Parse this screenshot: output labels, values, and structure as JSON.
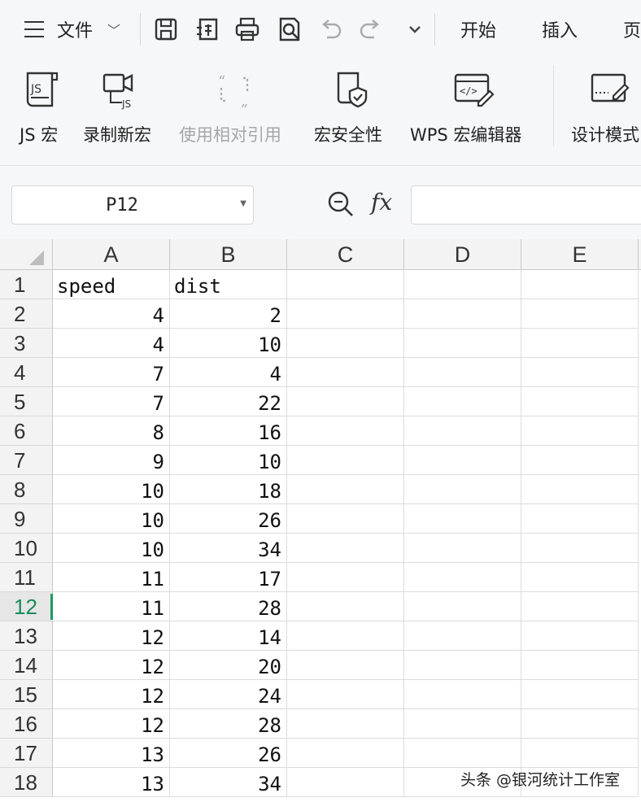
{
  "menubar": {
    "file_label": "文件",
    "quick_access_icons": [
      "save-icon",
      "save-as-icon",
      "print-icon",
      "print-preview-icon",
      "undo-icon",
      "redo-icon",
      "more-dropdown-icon"
    ],
    "tabs": [
      "开始",
      "插入",
      "页"
    ]
  },
  "ribbon": {
    "buttons": [
      {
        "label": "JS 宏",
        "icon": "js-macro-icon",
        "enabled": true
      },
      {
        "label": "录制新宏",
        "icon": "record-macro-icon",
        "enabled": true
      },
      {
        "label": "使用相对引用",
        "icon": "relative-reference-icon",
        "enabled": false
      },
      {
        "label": "宏安全性",
        "icon": "macro-security-icon",
        "enabled": true
      },
      {
        "label": "WPS 宏编辑器",
        "icon": "macro-editor-icon",
        "enabled": true
      },
      {
        "label": "设计模式",
        "icon": "design-mode-icon",
        "enabled": true
      }
    ]
  },
  "formula_bar": {
    "name_box": "P12",
    "fx": "fx",
    "formula": ""
  },
  "sheet": {
    "columns": [
      "A",
      "B",
      "C",
      "D",
      "E"
    ],
    "active_row": "12",
    "rows": [
      {
        "n": "1",
        "a": "speed",
        "b": "dist"
      },
      {
        "n": "2",
        "a": "4",
        "b": "2"
      },
      {
        "n": "3",
        "a": "4",
        "b": "10"
      },
      {
        "n": "4",
        "a": "7",
        "b": "4"
      },
      {
        "n": "5",
        "a": "7",
        "b": "22"
      },
      {
        "n": "6",
        "a": "8",
        "b": "16"
      },
      {
        "n": "7",
        "a": "9",
        "b": "10"
      },
      {
        "n": "8",
        "a": "10",
        "b": "18"
      },
      {
        "n": "9",
        "a": "10",
        "b": "26"
      },
      {
        "n": "10",
        "a": "10",
        "b": "34"
      },
      {
        "n": "11",
        "a": "11",
        "b": "17"
      },
      {
        "n": "12",
        "a": "11",
        "b": "28"
      },
      {
        "n": "13",
        "a": "12",
        "b": "14"
      },
      {
        "n": "14",
        "a": "12",
        "b": "20"
      },
      {
        "n": "15",
        "a": "12",
        "b": "24"
      },
      {
        "n": "16",
        "a": "12",
        "b": "28"
      },
      {
        "n": "17",
        "a": "13",
        "b": "26"
      },
      {
        "n": "18",
        "a": "13",
        "b": "34"
      }
    ]
  },
  "watermark": "头条 @银河统计工作室",
  "colors": {
    "active_row_accent": "#1a9a63",
    "header_bg": "#f3f3f3",
    "toolbar_bg": "#f6f7f9",
    "disabled_text": "#a7a7a7"
  }
}
